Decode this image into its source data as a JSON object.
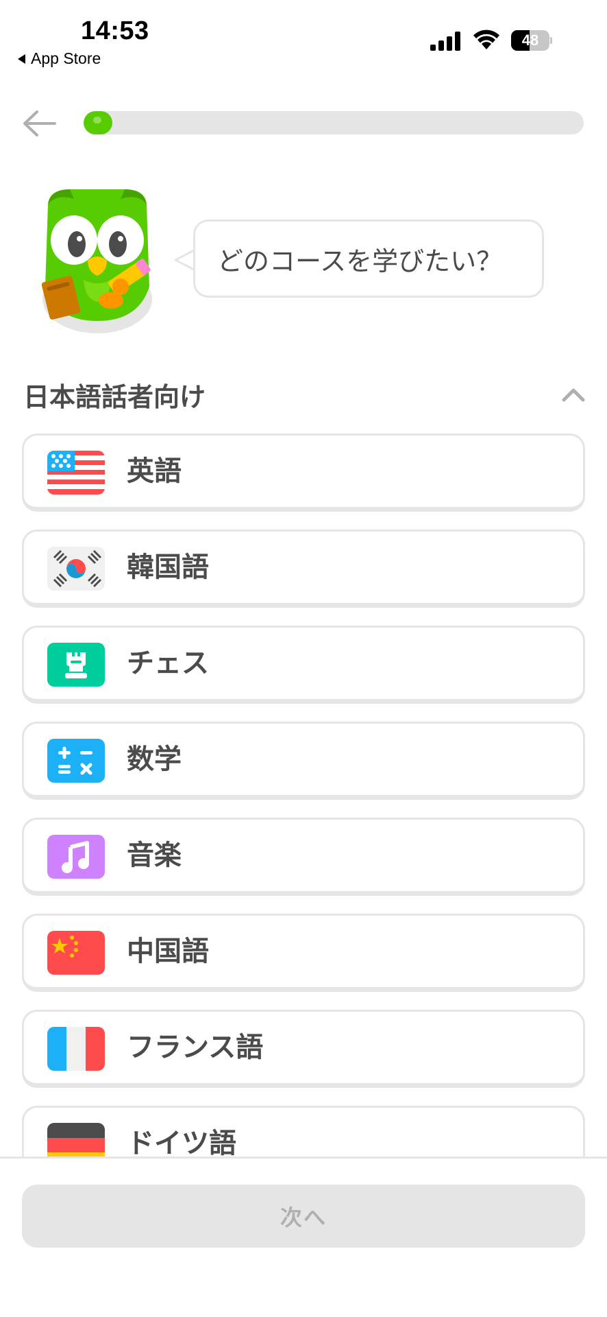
{
  "status_bar": {
    "time": "14:53",
    "back_app": "App Store",
    "battery_level": 48,
    "battery_text": "48"
  },
  "header": {
    "back_icon": "arrow-left-icon",
    "progress_percent": 5,
    "progress_color": "#58cc02"
  },
  "prompt": {
    "mascot": "duo-owl-mascot",
    "question": "どのコースを学びたい？"
  },
  "section": {
    "title": "日本語話者向け",
    "toggle_icon": "chevron-up-icon"
  },
  "courses": [
    {
      "label": "英語",
      "icon": "us-flag-icon"
    },
    {
      "label": "韓国語",
      "icon": "korea-flag-icon"
    },
    {
      "label": "チェス",
      "icon": "chess-rook-icon"
    },
    {
      "label": "数学",
      "icon": "math-symbols-icon"
    },
    {
      "label": "音楽",
      "icon": "music-note-icon"
    },
    {
      "label": "中国語",
      "icon": "china-flag-icon"
    },
    {
      "label": "フランス語",
      "icon": "france-flag-icon"
    },
    {
      "label": "ドイツ語",
      "icon": "germany-flag-icon"
    }
  ],
  "footer": {
    "next_label": "次へ",
    "next_enabled": false
  },
  "colors": {
    "border": "#e5e5e5",
    "text": "#4b4b4b",
    "disabled_text": "#afafaf",
    "brand_green": "#58cc02"
  }
}
